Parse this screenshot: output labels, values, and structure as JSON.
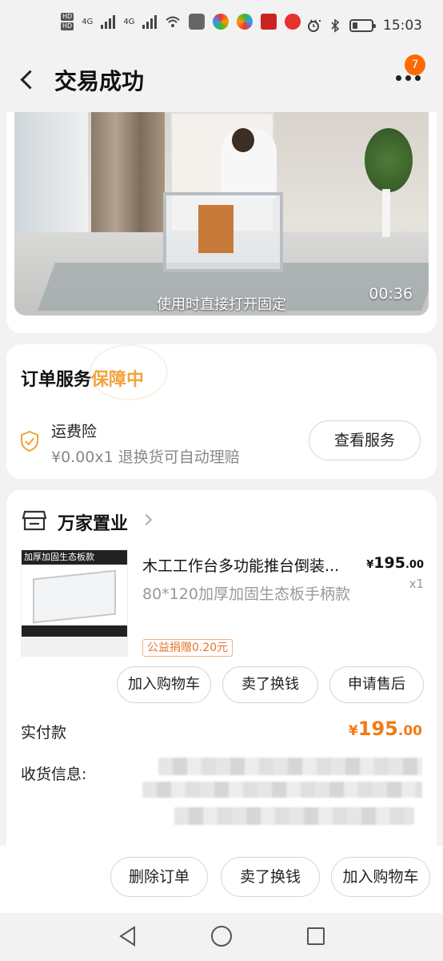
{
  "status_bar": {
    "time": "15:03",
    "network": [
      "4G",
      "4G"
    ],
    "more": "···"
  },
  "header": {
    "title": "交易成功",
    "badge_count": "7"
  },
  "video": {
    "caption": "使用时直接打开固定",
    "duration": "00:36"
  },
  "service": {
    "title": "订单服务",
    "status": "保障中",
    "insurance_name": "运费险",
    "insurance_desc": "¥0.00x1  退换货可自动理赔",
    "view_button": "查看服务"
  },
  "order": {
    "store_name": "万家置业",
    "product_image_tag": "加厚加固生态板款",
    "product_title": "木工工作台多功能推台倒装...",
    "price_symbol": "¥",
    "price_main": "195",
    "price_decimal": ".00",
    "quantity": "x1",
    "spec": "80*120加厚加固生态板手柄款",
    "charity": "公益捐赠0.20元",
    "btn_add_cart": "加入购物车",
    "btn_sell": "卖了换钱",
    "btn_after_sale": "申请售后",
    "paid_label": "实付款",
    "paid_symbol": "¥",
    "paid_main": "195",
    "paid_decimal": ".00",
    "address_label": "收货信息:"
  },
  "bottom_bar": {
    "delete": "删除订单",
    "sell": "卖了换钱",
    "add_cart": "加入购物车"
  },
  "colors": {
    "accent": "#f07a16",
    "badge": "#ff6a00",
    "guarantee": "#f2a33a"
  }
}
